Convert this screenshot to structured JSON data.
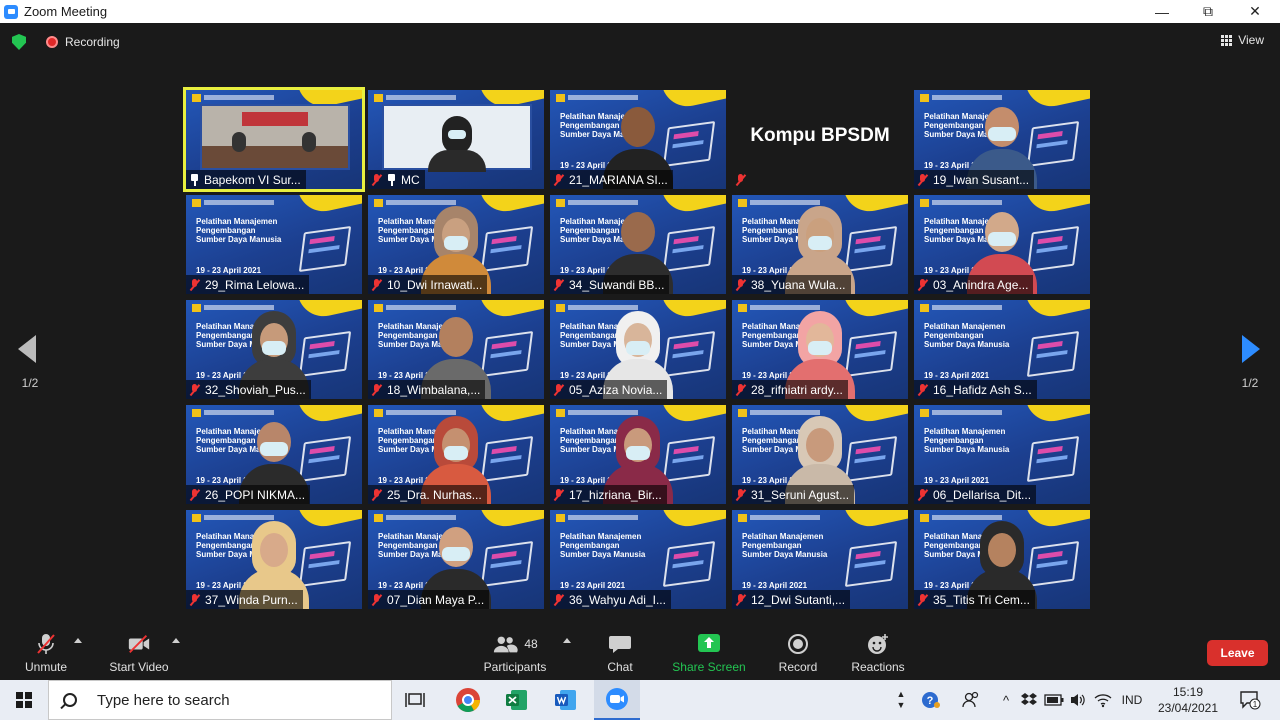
{
  "window": {
    "title": "Zoom Meeting",
    "minimize": "—",
    "maximize": "⧉",
    "close": "✕"
  },
  "topbar": {
    "recording_label": "Recording",
    "view_label": "View"
  },
  "pager": {
    "left_page": "1/2",
    "right_page": "1/2"
  },
  "slide": {
    "heading": "Pelatihan Manajemen Pengembangan Sumber Daya Manusia",
    "date": "19 - 23 April 2021"
  },
  "tiles": [
    {
      "name": "Bapekom VI Sur...",
      "kind": "room",
      "muted": false,
      "pinned": true,
      "active": true
    },
    {
      "name": "MC",
      "kind": "mc",
      "muted": true,
      "pinned": true,
      "active": false
    },
    {
      "name": "21_MARIANA SI...",
      "kind": "person",
      "muted": true,
      "skin": "#8a5a3c",
      "top": "#222222",
      "mask": false,
      "hijab": ""
    },
    {
      "name": "",
      "kind": "text",
      "text": "Kompu BPSDM",
      "muted": true
    },
    {
      "name": "19_Iwan Susant...",
      "kind": "person",
      "muted": true,
      "skin": "#c48d6c",
      "top": "#3b5a8a",
      "mask": true,
      "hijab": ""
    },
    {
      "name": "29_Rima Lelowa...",
      "kind": "slide",
      "muted": true
    },
    {
      "name": "10_Dwi Irnawati...",
      "kind": "person",
      "muted": true,
      "skin": "#c9a080",
      "top": "#d08a3a",
      "mask": true,
      "hijab": "#a7846a"
    },
    {
      "name": "34_Suwandi BB...",
      "kind": "person",
      "muted": true,
      "skin": "#9a6a4c",
      "top": "#2d2d2d",
      "mask": false,
      "hijab": ""
    },
    {
      "name": "38_Yuana Wula...",
      "kind": "person",
      "muted": true,
      "skin": "#caa07e",
      "top": "#c9a58a",
      "mask": true,
      "hijab": "#c9a58a"
    },
    {
      "name": "03_Anindra Age...",
      "kind": "person",
      "muted": true,
      "skin": "#d2a98a",
      "top": "#d24a52",
      "mask": true,
      "hijab": ""
    },
    {
      "name": "32_Shoviah_Pus...",
      "kind": "person",
      "muted": true,
      "skin": "#c69a7a",
      "top": "#3d3d3d",
      "mask": true,
      "hijab": "#3d3d3d"
    },
    {
      "name": "18_Wimbalana,...",
      "kind": "person",
      "muted": true,
      "skin": "#b3805e",
      "top": "#6a6a6a",
      "mask": false,
      "hijab": ""
    },
    {
      "name": "05_Aziza Novia...",
      "kind": "person",
      "muted": true,
      "skin": "#d8b59a",
      "top": "#e6e6e6",
      "mask": true,
      "hijab": "#f0f0f0"
    },
    {
      "name": "28_rifniatri ardy...",
      "kind": "person",
      "muted": true,
      "skin": "#e2b79a",
      "top": "#e36f6f",
      "mask": true,
      "hijab": "#f2a4a4"
    },
    {
      "name": "16_Hafidz Ash S...",
      "kind": "slide",
      "muted": true
    },
    {
      "name": "26_POPI NIKMA...",
      "kind": "person",
      "muted": true,
      "skin": "#b8866a",
      "top": "#2b2b2b",
      "mask": true,
      "hijab": ""
    },
    {
      "name": "25_Dra. Nurhas...",
      "kind": "person",
      "muted": true,
      "skin": "#c59070",
      "top": "#d85a40",
      "mask": true,
      "hijab": "#b94a3a"
    },
    {
      "name": "17_hizriana_Bir...",
      "kind": "person",
      "muted": true,
      "skin": "#c99a7c",
      "top": "#8a2a48",
      "mask": true,
      "hijab": "#8a2a48"
    },
    {
      "name": "31_Seruni Agust...",
      "kind": "person",
      "muted": true,
      "skin": "#c89a7c",
      "top": "#c9b9a8",
      "mask": false,
      "hijab": "#d8c8b6"
    },
    {
      "name": "06_Dellarisa_Dit...",
      "kind": "slide",
      "muted": true
    },
    {
      "name": "37_Winda Purn...",
      "kind": "person",
      "muted": true,
      "skin": "#d8aa8a",
      "top": "#e8c88a",
      "mask": false,
      "hijab": "#e8c88a"
    },
    {
      "name": "07_Dian Maya P...",
      "kind": "person",
      "muted": true,
      "skin": "#d0a080",
      "top": "#2a2a2a",
      "mask": true,
      "hijab": ""
    },
    {
      "name": "36_Wahyu Adi_I...",
      "kind": "slide",
      "muted": true
    },
    {
      "name": "12_Dwi Sutanti,...",
      "kind": "slide",
      "muted": true
    },
    {
      "name": "35_Titis Tri Cem...",
      "kind": "person",
      "muted": true,
      "skin": "#b5825f",
      "top": "#2a2a2a",
      "mask": false,
      "hijab": "#2a2a2a"
    }
  ],
  "toolbar": {
    "unmute": "Unmute",
    "start_video": "Start Video",
    "participants": "Participants",
    "participants_count": "48",
    "chat": "Chat",
    "share_screen": "Share Screen",
    "record": "Record",
    "reactions": "Reactions",
    "leave": "Leave"
  },
  "colors": {
    "share_green": "#23c552",
    "leave_red": "#d9302c",
    "active_yellow": "#e8ef3f",
    "zoom_blue": "#2d8cff"
  },
  "taskbar": {
    "search_placeholder": "Type here to search",
    "language": "IND",
    "time": "15:19",
    "date": "23/04/2021",
    "notification_count": "1"
  }
}
